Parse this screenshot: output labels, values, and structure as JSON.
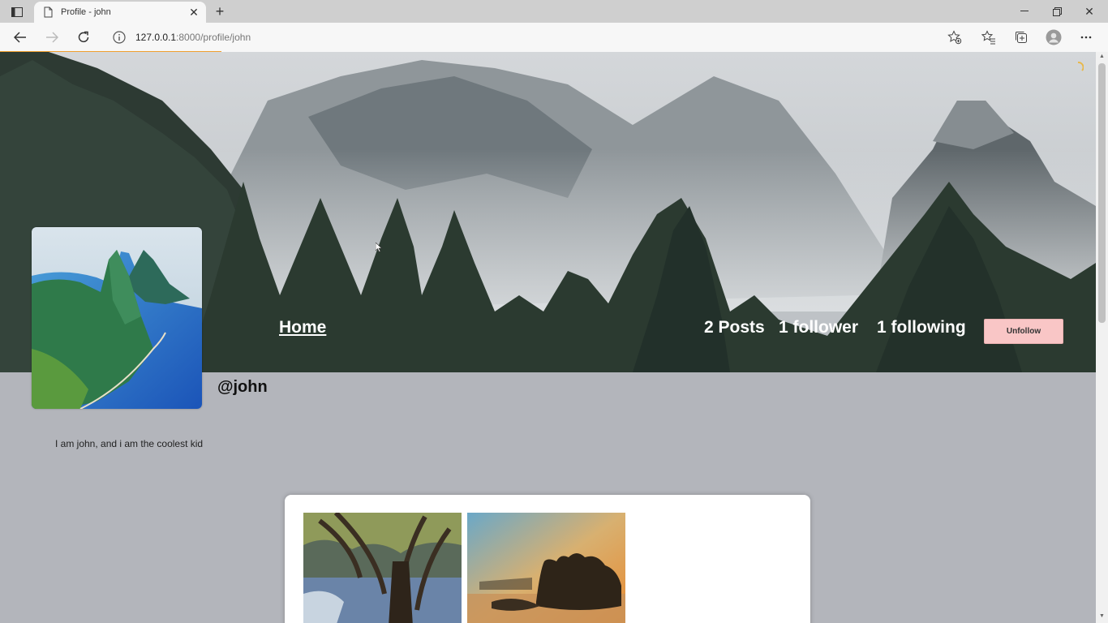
{
  "browser": {
    "tab_title": "Profile - john",
    "new_tab_label": "+",
    "url_host": "127.0.0.1",
    "url_path": ":8000/profile/john"
  },
  "nav": {
    "home_label": "Home"
  },
  "stats": {
    "posts": "2 Posts",
    "followers": "1 follower",
    "following": "1 following"
  },
  "actions": {
    "unfollow_label": "Unfollow"
  },
  "profile": {
    "username": "@john",
    "bio": "I am john, and i am the coolest kid"
  },
  "colors": {
    "page_bg": "#b3b5bb",
    "unfollow_bg": "#f9c6c6",
    "load_progress": "#f0a030"
  },
  "page_load_progress": 0.2
}
